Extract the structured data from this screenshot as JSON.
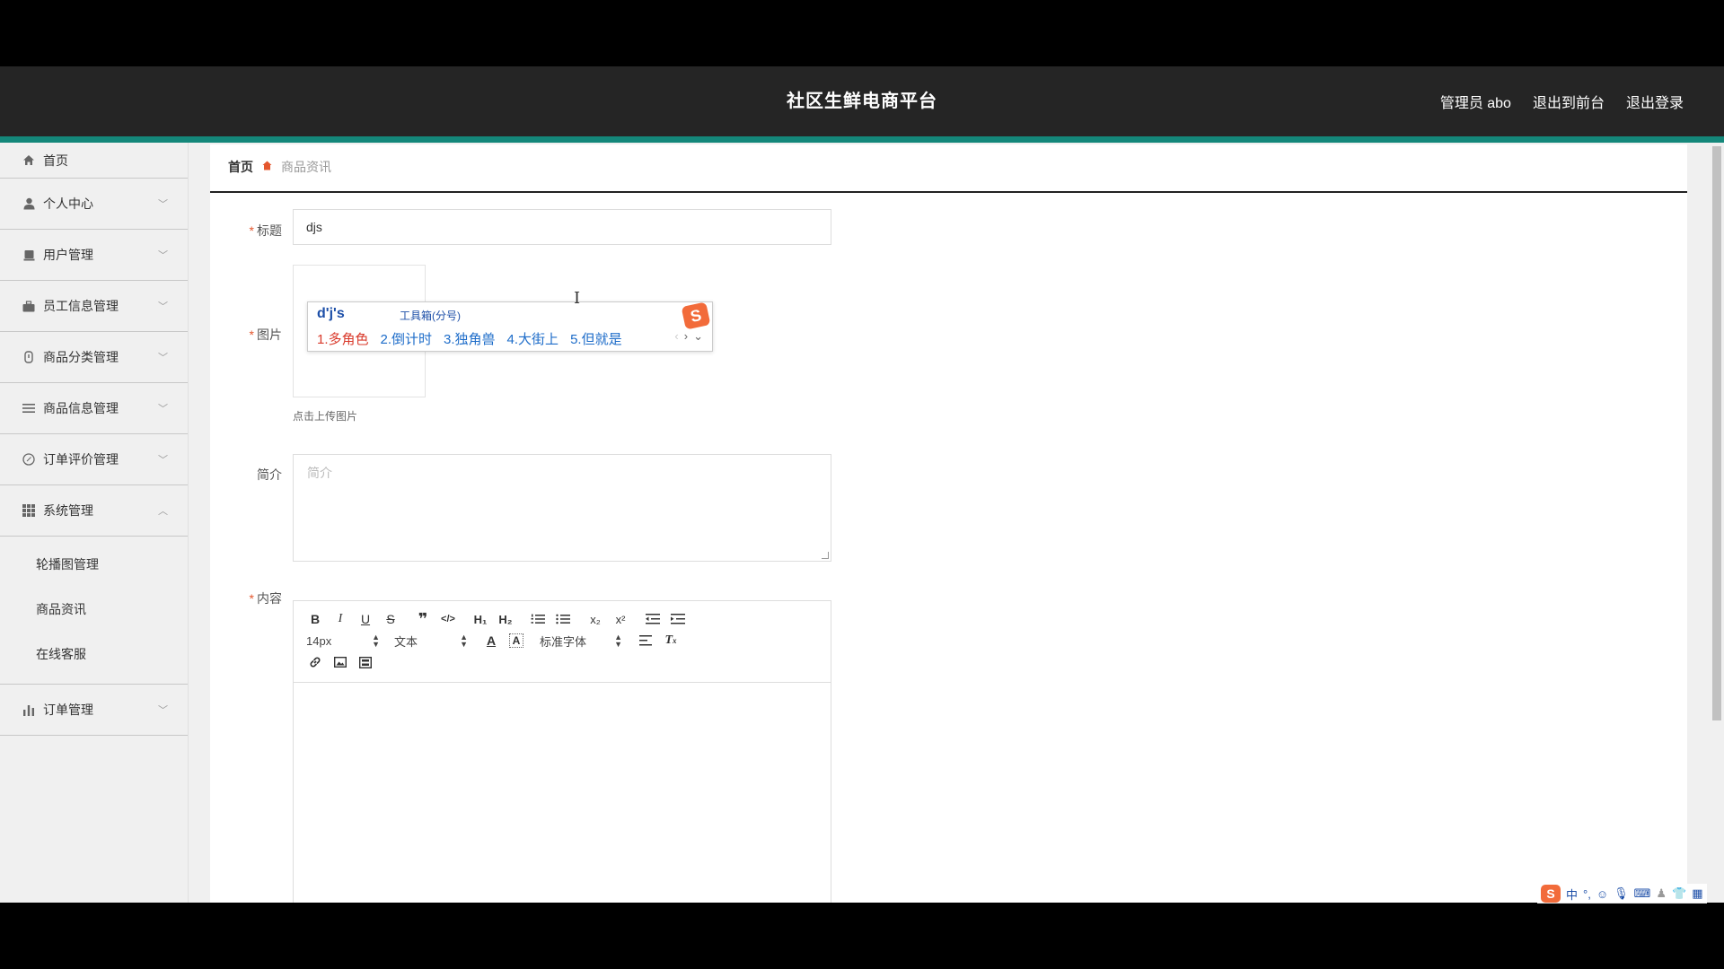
{
  "header": {
    "title": "社区生鲜电商平台",
    "admin_label": "管理员 abo",
    "exit_front": "退出到前台",
    "logout": "退出登录"
  },
  "sidebar": {
    "items": [
      {
        "label": "首页",
        "icon": "home-icon"
      },
      {
        "label": "个人中心",
        "icon": "user-icon"
      },
      {
        "label": "用户管理",
        "icon": "users-icon"
      },
      {
        "label": "员工信息管理",
        "icon": "briefcase-icon"
      },
      {
        "label": "商品分类管理",
        "icon": "category-icon"
      },
      {
        "label": "商品信息管理",
        "icon": "list-icon"
      },
      {
        "label": "订单评价管理",
        "icon": "compass-icon"
      },
      {
        "label": "系统管理",
        "icon": "grid-icon"
      },
      {
        "label": "订单管理",
        "icon": "bar-chart-icon"
      }
    ],
    "system_submenu": [
      "轮播图管理",
      "商品资讯",
      "在线客服"
    ]
  },
  "breadcrumb": {
    "home": "首页",
    "current": "商品资讯"
  },
  "form": {
    "title_label": "标题",
    "title_value": "djs",
    "image_label": "图片",
    "upload_plus": "+",
    "upload_tip": "点击上传图片",
    "intro_label": "简介",
    "intro_placeholder": "简介",
    "content_label": "内容"
  },
  "editor": {
    "font_size": "14px",
    "format": "文本",
    "font_family": "标准字体"
  },
  "ime": {
    "composition": "d'j's",
    "toolbox": "工具箱(分号)",
    "candidates": [
      "1.多角色",
      "2.倒计时",
      "3.独角兽",
      "4.大街上",
      "5.但就是"
    ],
    "logo": "S"
  },
  "tray": {
    "lang": "中",
    "punct": "°,"
  },
  "colors": {
    "header_bg": "#252525",
    "accent": "#14877a",
    "required": "#e4572e"
  }
}
